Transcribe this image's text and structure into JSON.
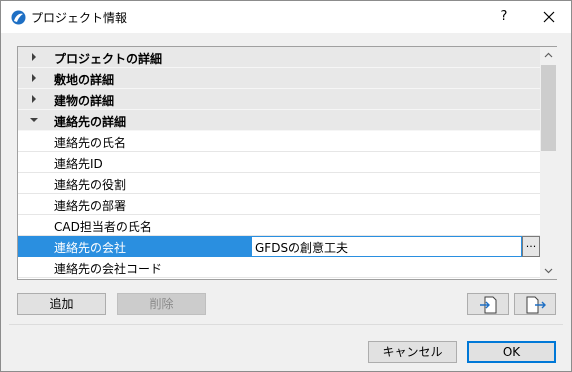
{
  "window": {
    "title": "プロジェクト情報",
    "help_label": "?",
    "app_icon": "archicad-icon",
    "close_icon": "close-icon"
  },
  "list": {
    "groups": [
      {
        "label": "プロジェクトの詳細",
        "expanded": false
      },
      {
        "label": "敷地の詳細",
        "expanded": false
      },
      {
        "label": "建物の詳細",
        "expanded": false
      },
      {
        "label": "連絡先の詳細",
        "expanded": true
      }
    ],
    "items": [
      {
        "label": "連絡先の氏名"
      },
      {
        "label": "連絡先ID"
      },
      {
        "label": "連絡先の役割"
      },
      {
        "label": "連絡先の部署"
      },
      {
        "label": "CAD担当者の氏名"
      },
      {
        "label": "連絡先の会社",
        "value": "GFDSの創意工夫",
        "selected": true
      },
      {
        "label": "連絡先の会社コード"
      }
    ],
    "browse_label": "..."
  },
  "buttons": {
    "add": "追加",
    "delete": "削除",
    "import_icon": "import-file-icon",
    "export_icon": "export-file-icon",
    "cancel": "キャンセル",
    "ok": "OK"
  },
  "colors": {
    "selection": "#2a8fe0",
    "group_bg": "#e8e8e8"
  }
}
